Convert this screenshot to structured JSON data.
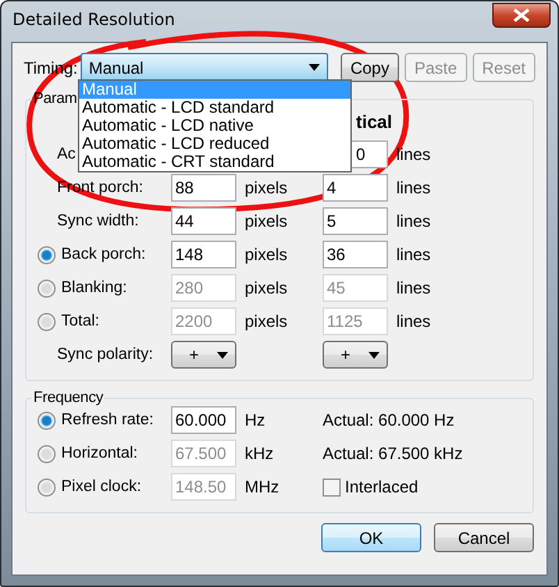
{
  "window": {
    "title": "Detailed Resolution"
  },
  "timing": {
    "label": "Timing:",
    "value": "Manual",
    "expanded": true,
    "options": [
      {
        "label": "Manual",
        "selected": true
      },
      {
        "label": "Automatic - LCD standard",
        "selected": false
      },
      {
        "label": "Automatic - LCD native",
        "selected": false
      },
      {
        "label": "Automatic - LCD reduced",
        "selected": false
      },
      {
        "label": "Automatic - CRT standard",
        "selected": false
      }
    ]
  },
  "actions": [
    {
      "label": "Copy",
      "disabled": false
    },
    {
      "label": "Paste",
      "disabled": true
    },
    {
      "label": "Reset",
      "disabled": true
    }
  ],
  "parameters": {
    "title": "Param",
    "vertical_header": "tical",
    "rows": [
      {
        "kind": "field",
        "label": "Ac",
        "vertical": {
          "value": "0",
          "disabled": false,
          "covered": true
        },
        "v_unit": "lines"
      },
      {
        "kind": "field",
        "label": "Front porch:",
        "horizontal": {
          "value": "88",
          "disabled": false
        },
        "h_unit": "pixels",
        "vertical": {
          "value": "4",
          "disabled": false
        },
        "v_unit": "lines"
      },
      {
        "kind": "field",
        "label": "Sync width:",
        "horizontal": {
          "value": "44",
          "disabled": false
        },
        "h_unit": "pixels",
        "vertical": {
          "value": "5",
          "disabled": false
        },
        "v_unit": "lines"
      },
      {
        "kind": "radio",
        "label": "Back porch:",
        "selected": true,
        "horizontal": {
          "value": "148",
          "disabled": false
        },
        "h_unit": "pixels",
        "vertical": {
          "value": "36",
          "disabled": false
        },
        "v_unit": "lines"
      },
      {
        "kind": "radio",
        "label": "Blanking:",
        "selected": false,
        "horizontal": {
          "value": "280",
          "disabled": true
        },
        "h_unit": "pixels",
        "vertical": {
          "value": "45",
          "disabled": true
        },
        "v_unit": "lines"
      },
      {
        "kind": "radio",
        "label": "Total:",
        "selected": false,
        "horizontal": {
          "value": "2200",
          "disabled": true
        },
        "h_unit": "pixels",
        "vertical": {
          "value": "1125",
          "disabled": true
        },
        "v_unit": "lines"
      },
      {
        "kind": "polarity",
        "label": "Sync polarity:",
        "horizontal": "+",
        "vertical": "+"
      }
    ]
  },
  "frequency": {
    "title": "Frequency",
    "rows": [
      {
        "kind": "actual",
        "label": "Refresh rate:",
        "selected": true,
        "value": "60.000",
        "disabled": false,
        "unit": "Hz",
        "actual": "Actual: 60.000 Hz"
      },
      {
        "kind": "actual",
        "label": "Horizontal:",
        "selected": false,
        "value": "67.500",
        "disabled": true,
        "unit": "kHz",
        "actual": "Actual: 67.500 kHz"
      },
      {
        "kind": "checkbox",
        "label": "Pixel clock:",
        "selected": false,
        "value": "148.50",
        "disabled": true,
        "unit": "MHz",
        "checkbox": {
          "label": "Interlaced",
          "checked": false
        }
      }
    ]
  },
  "dialog_buttons": [
    {
      "label": "OK",
      "default": true
    },
    {
      "label": "Cancel",
      "default": false
    }
  ],
  "annotation": {
    "kind": "circle"
  }
}
